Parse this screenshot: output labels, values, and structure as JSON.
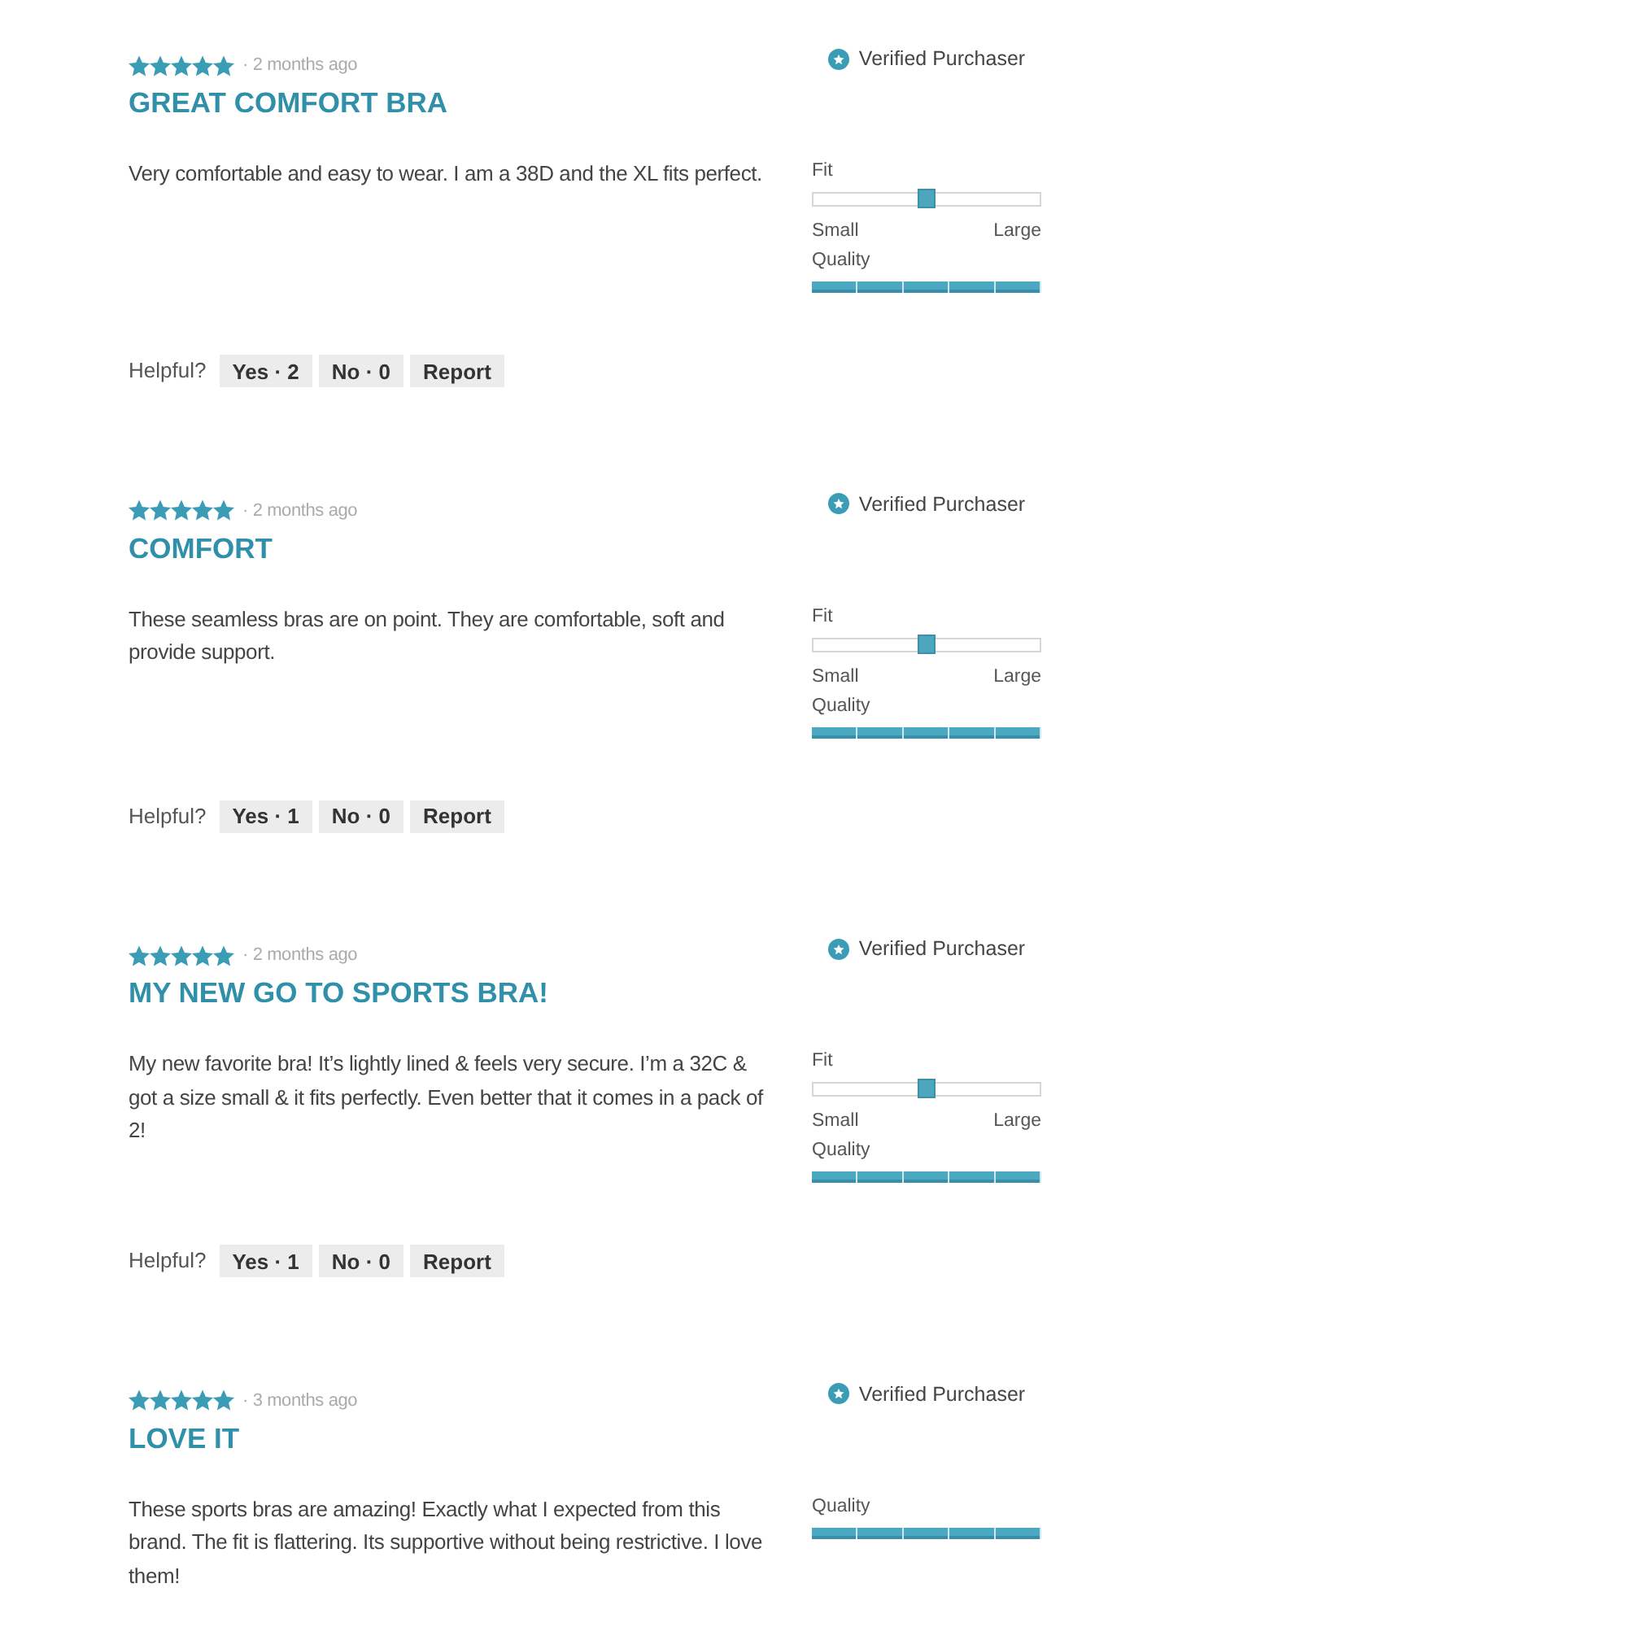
{
  "reviews": [
    {
      "stars": 5,
      "date": "· 2 months ago",
      "title": "GREAT COMFORT BRA",
      "body": "Very comfortable and easy to wear. I am a 38D and the XL fits perfect.",
      "verified": "Verified Purchaser",
      "fit": {
        "label": "Fit",
        "level": 0.5,
        "min_label": "Small",
        "max_label": "Large"
      },
      "quality": {
        "label": "Quality",
        "level": 1
      },
      "helpful": {
        "label": "Helpful?",
        "buttons": [
          "Yes · 2",
          "No · 0",
          "Report"
        ]
      }
    },
    {
      "stars": 5,
      "date": "· 2 months ago",
      "title": "COMFORT",
      "body": "These seamless bras are on point. They are comfortable, soft and provide support.",
      "verified": "Verified Purchaser",
      "fit": {
        "label": "Fit",
        "level": 0.5,
        "min_label": "Small",
        "max_label": "Large"
      },
      "quality": {
        "label": "Quality",
        "level": 1
      },
      "helpful": {
        "label": "Helpful?",
        "buttons": [
          "Yes · 1",
          "No · 0",
          "Report"
        ]
      }
    },
    {
      "stars": 5,
      "date": "· 2 months ago",
      "title": "MY NEW GO TO SPORTS BRA!",
      "body": "My new favorite bra! It’s lightly lined & feels very secure. I’m a 32C & got a size small & it fits perfectly. Even better that it comes in a pack of 2!",
      "verified": "Verified Purchaser",
      "fit": {
        "label": "Fit",
        "level": 0.5,
        "min_label": "Small",
        "max_label": "Large"
      },
      "quality": {
        "label": "Quality",
        "level": 1
      },
      "helpful": {
        "label": "Helpful?",
        "buttons": [
          "Yes · 1",
          "No · 0",
          "Report"
        ]
      }
    },
    {
      "stars": 5,
      "date": "· 3 months ago",
      "title": "LOVE IT",
      "body": "These sports bras are amazing! Exactly what I expected from this brand. The fit is flattering. Its supportive without being restrictive. I love them!",
      "verified": "Verified Purchaser",
      "quality": {
        "label": "Quality",
        "level": 1
      }
    }
  ]
}
